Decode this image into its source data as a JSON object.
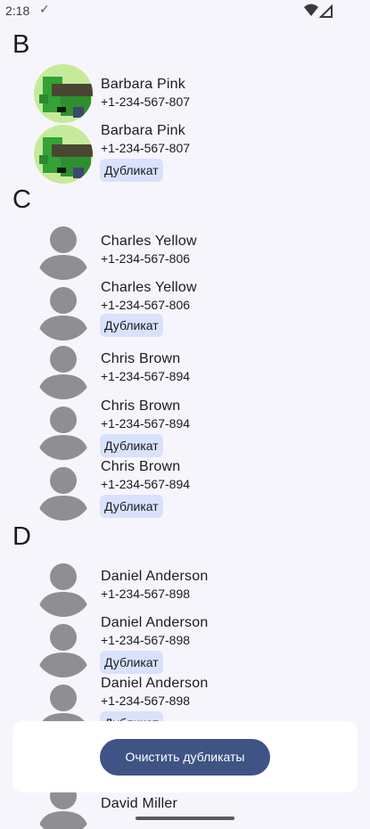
{
  "status_bar": {
    "time": "2:18",
    "check_glyph": "✓",
    "icons": [
      "wifi-icon",
      "cellular-signal-icon"
    ]
  },
  "sections": [
    {
      "letter": "B"
    },
    {
      "letter": "C"
    },
    {
      "letter": "D"
    }
  ],
  "contacts": [
    {
      "name": "Barbara Pink",
      "phone": "+1-234-567-807",
      "duplicate": false,
      "avatar": "pixel-art-photo"
    },
    {
      "name": "Barbara Pink",
      "phone": "+1-234-567-807",
      "duplicate": true,
      "avatar": "pixel-art-photo"
    },
    {
      "name": "Charles Yellow",
      "phone": "+1-234-567-806",
      "duplicate": false,
      "avatar": "default-person"
    },
    {
      "name": "Charles Yellow",
      "phone": "+1-234-567-806",
      "duplicate": true,
      "avatar": "default-person"
    },
    {
      "name": "Chris Brown",
      "phone": "+1-234-567-894",
      "duplicate": false,
      "avatar": "default-person"
    },
    {
      "name": "Chris Brown",
      "phone": "+1-234-567-894",
      "duplicate": true,
      "avatar": "default-person"
    },
    {
      "name": "Chris Brown",
      "phone": "+1-234-567-894",
      "duplicate": true,
      "avatar": "default-person"
    },
    {
      "name": "Daniel Anderson",
      "phone": "+1-234-567-898",
      "duplicate": false,
      "avatar": "default-person"
    },
    {
      "name": "Daniel Anderson",
      "phone": "+1-234-567-898",
      "duplicate": true,
      "avatar": "default-person"
    },
    {
      "name": "Daniel Anderson",
      "phone": "+1-234-567-898",
      "duplicate": true,
      "avatar": "default-person"
    },
    {
      "name": "David Miller",
      "phone": "",
      "duplicate": false,
      "avatar": "default-person"
    }
  ],
  "duplicate_label": "Дубликат",
  "clear_button_label": "Очистить дубликаты",
  "colors": {
    "background": "#f7f5fc",
    "chip_background": "#d9e2fb",
    "button_background": "#3f5484",
    "avatar_gray": "#8e8e93",
    "avatar_green_bg": "#c5eb9a"
  }
}
